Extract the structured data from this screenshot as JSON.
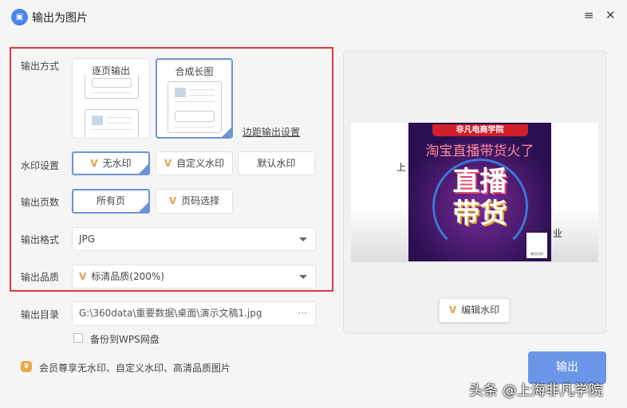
{
  "window": {
    "title": "输出为图片",
    "icon": "image-icon",
    "menu_icon": "≡",
    "close_icon": "✕"
  },
  "output_mode": {
    "label": "输出方式",
    "options": [
      {
        "label": "逐页输出",
        "selected": false
      },
      {
        "label": "合成长图",
        "selected": true
      }
    ],
    "margin_link": "边距输出设置"
  },
  "watermark": {
    "label": "水印设置",
    "options": [
      {
        "label": "无水印",
        "vip": true,
        "selected": true
      },
      {
        "label": "自定义水印",
        "vip": true,
        "selected": false
      },
      {
        "label": "默认水印",
        "vip": false,
        "selected": false
      }
    ]
  },
  "pages": {
    "label": "输出页数",
    "options": [
      {
        "label": "所有页",
        "selected": true
      },
      {
        "label": "页码选择",
        "vip": true,
        "selected": false
      }
    ]
  },
  "format": {
    "label": "输出格式",
    "value": "JPG"
  },
  "quality": {
    "label": "输出品质",
    "value": "标清品质(200%)"
  },
  "directory": {
    "label": "输出目录",
    "value": "G:\\360data\\重要数据\\桌面\\演示文稿1.jpg",
    "more": "···"
  },
  "backup": {
    "label": "备份到WPS网盘",
    "checked": false
  },
  "member_note": "会员尊享无水印、自定义水印、高清品质图片",
  "preview": {
    "brand": "非凡电商学院",
    "headline": "淘宝直播带货火了",
    "big1": "直播",
    "big2": "带货",
    "qr_caption": "微信扫码",
    "edit_watermark": "编辑水印",
    "side_left": "上",
    "side_right": "业"
  },
  "vip_mark": "V",
  "output_button": "输出",
  "overlay_watermark": "头条 @上海非凡学院",
  "colors": {
    "accent": "#6b93d6",
    "highlight": "#d9393a",
    "vip": "#e0a04a",
    "primary": "#6b96e8"
  }
}
